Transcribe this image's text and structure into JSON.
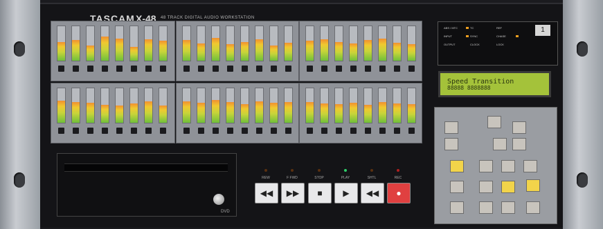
{
  "header": {
    "brand": "TASCAM",
    "model": "X-48",
    "subtitle": "48 TRACK DIGITAL AUDIO WORKSTATION"
  },
  "meters": {
    "panel_count": 6,
    "channels_per_panel": 8,
    "levels": [
      [
        0.55,
        0.6,
        0.45,
        0.7,
        0.65,
        0.4,
        0.62,
        0.58
      ],
      [
        0.6,
        0.5,
        0.66,
        0.48,
        0.55,
        0.62,
        0.45,
        0.52
      ],
      [
        0.58,
        0.62,
        0.55,
        0.5,
        0.6,
        0.64,
        0.52,
        0.48
      ],
      [
        0.64,
        0.6,
        0.58,
        0.52,
        0.5,
        0.56,
        0.62,
        0.5
      ],
      [
        0.62,
        0.58,
        0.66,
        0.6,
        0.55,
        0.62,
        0.58,
        0.6
      ],
      [
        0.6,
        0.56,
        0.54,
        0.58,
        0.52,
        0.6,
        0.56,
        0.54
      ]
    ]
  },
  "status": {
    "labels": [
      "ABS / MTC",
      "INPUT",
      "OUTPUT",
      "TC",
      "SYNC",
      "CLOCK",
      "REF",
      "CHASE",
      "LOCK"
    ],
    "number": "1"
  },
  "lcd": {
    "line1": "Speed Transition",
    "line2": "88888 8888888"
  },
  "transport": {
    "labels": [
      "REW",
      "F FWD",
      "STOP",
      "PLAY",
      "SHTL",
      "REC"
    ],
    "glyphs": [
      "◀◀",
      "▶▶",
      "■",
      "▶",
      "◀◀",
      "●"
    ]
  },
  "cd": {
    "label": "DVD"
  },
  "colors": {
    "lcd": "#a4c23a",
    "meter_green": "#6fbf3a",
    "meter_yellow": "#f0c830",
    "record": "#e04040",
    "key_yellow": "#f2d44a"
  }
}
